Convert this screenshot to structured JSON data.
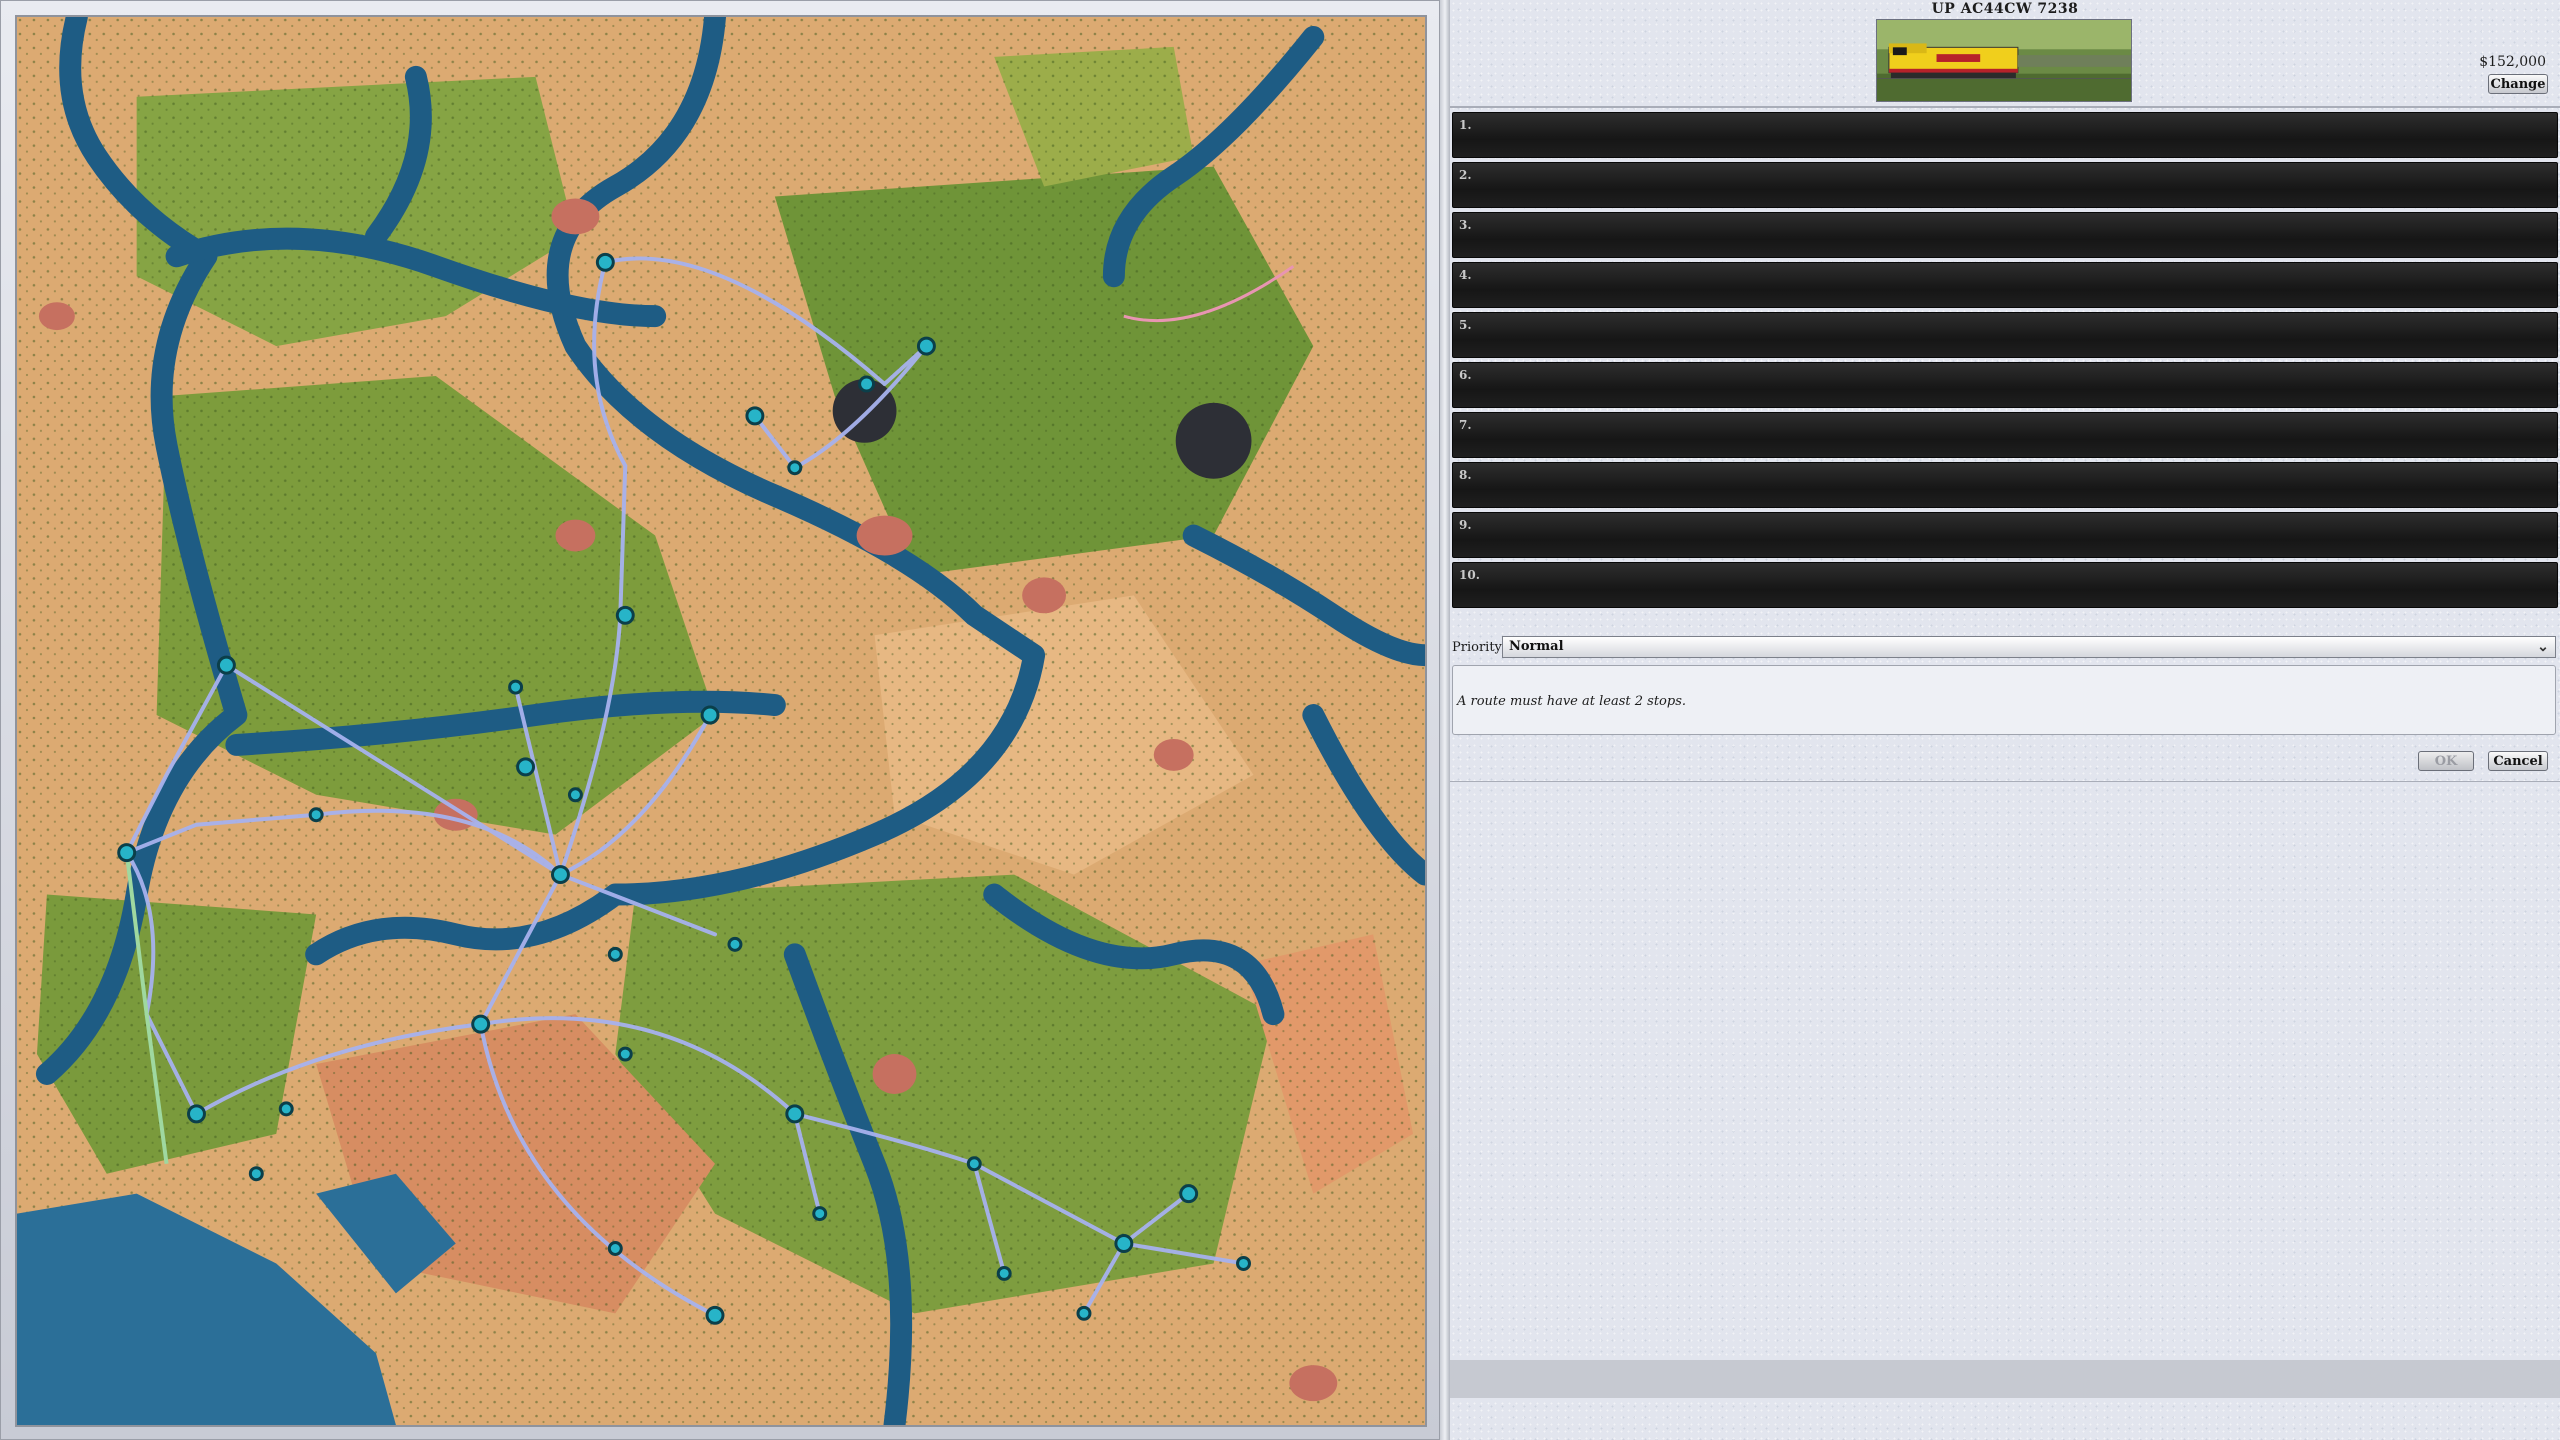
{
  "train": {
    "title": "UP AC44CW 7238",
    "price": "$152,000",
    "change_label": "Change"
  },
  "stops": [
    {
      "number": "1."
    },
    {
      "number": "2."
    },
    {
      "number": "3."
    },
    {
      "number": "4."
    },
    {
      "number": "5."
    },
    {
      "number": "6."
    },
    {
      "number": "7."
    },
    {
      "number": "8."
    },
    {
      "number": "9."
    },
    {
      "number": "10."
    }
  ],
  "priority": {
    "label": "Priority:",
    "selected": "Normal"
  },
  "message": "A route must have at least 2 stops.",
  "buttons": {
    "ok_label": "OK",
    "cancel_label": "Cancel"
  },
  "colors": {
    "river": "#1f5f86",
    "land_green": "#7a9a3e",
    "land_sand": "#e2b27a",
    "track": "#9aa8e6",
    "station": "#27b4c8"
  }
}
